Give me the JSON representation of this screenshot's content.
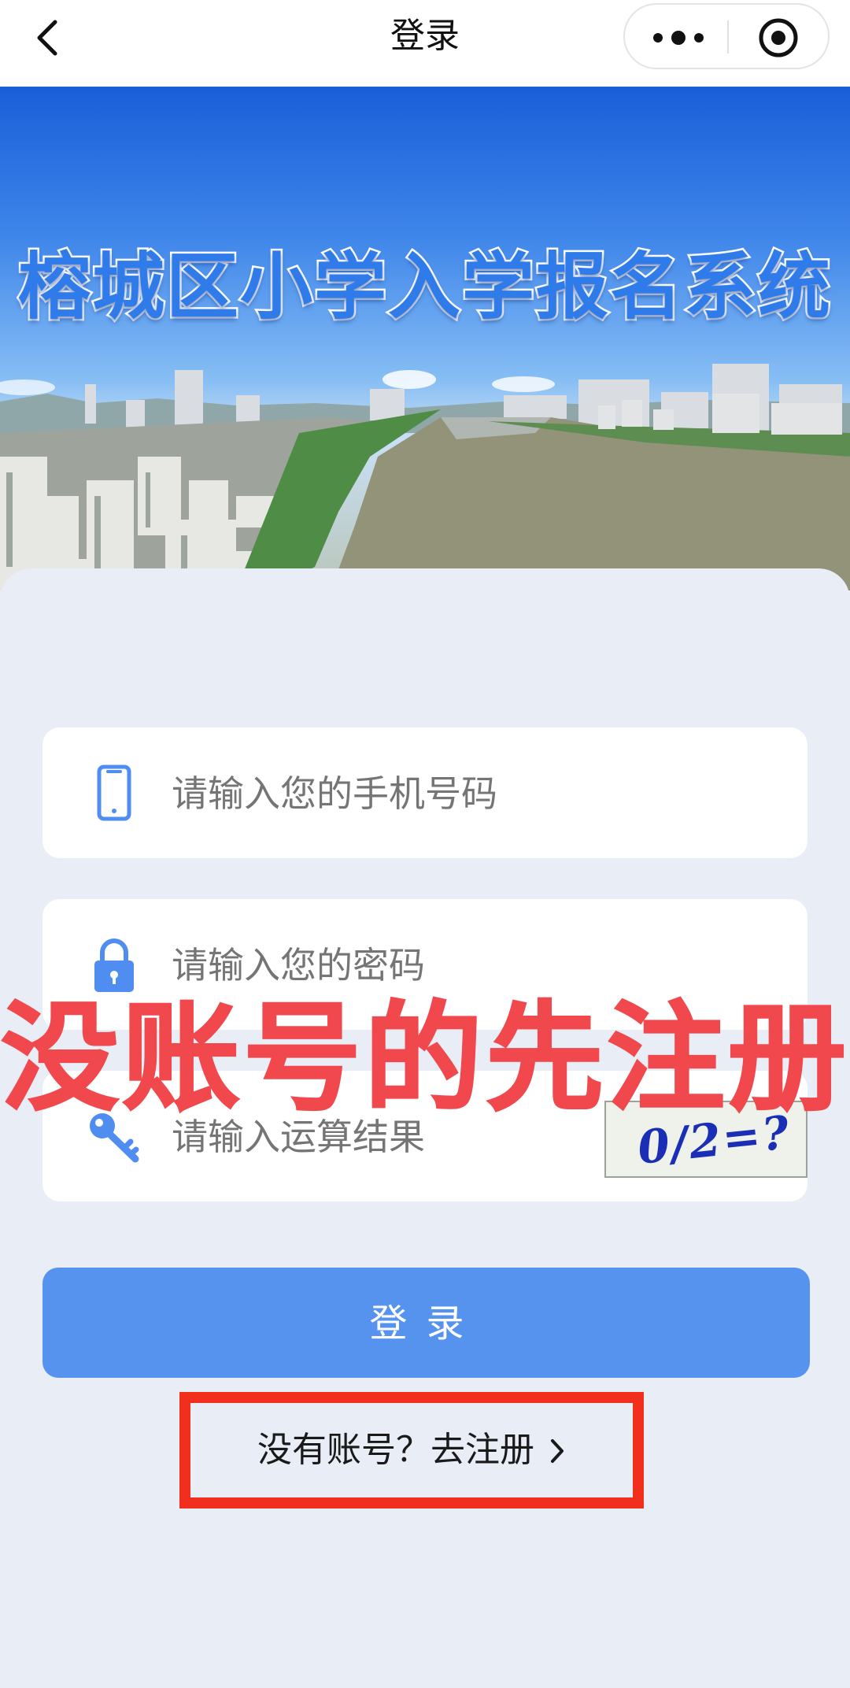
{
  "nav": {
    "title": "登录",
    "back_icon": "chevron-left-icon",
    "more_icon": "more-dots-icon",
    "close_icon": "target-circle-icon"
  },
  "banner": {
    "title": "榕城区小学入学报名系统"
  },
  "form": {
    "phone": {
      "placeholder": "请输入您的手机号码",
      "icon": "phone-icon"
    },
    "password": {
      "placeholder": "请输入您的密码",
      "icon": "lock-icon"
    },
    "captcha": {
      "placeholder": "请输入运算结果",
      "icon": "key-icon",
      "image_text": "0/2=?"
    },
    "login_label": "登录",
    "register_label": "没有账号？去注册"
  },
  "overlay": {
    "text": "没账号的先注册"
  },
  "colors": {
    "accent": "#5693ef",
    "overlay_red": "#f0484c",
    "highlight_box": "#f0301c"
  }
}
